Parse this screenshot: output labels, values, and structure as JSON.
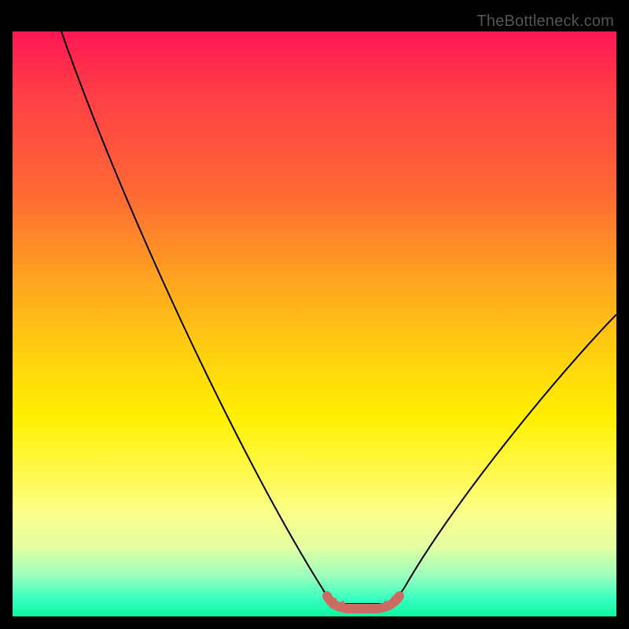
{
  "watermark": "TheBottleneck.com",
  "chart_data": {
    "type": "line",
    "title": "",
    "xlabel": "",
    "ylabel": "",
    "xlim": [
      0,
      100
    ],
    "ylim": [
      0,
      100
    ],
    "x": [
      0,
      5,
      10,
      15,
      20,
      25,
      30,
      35,
      40,
      45,
      50,
      52,
      54,
      56,
      58,
      60,
      62,
      64,
      70,
      75,
      80,
      85,
      90,
      95,
      100
    ],
    "values": [
      100,
      92,
      83,
      74,
      65,
      56,
      47,
      38,
      29,
      20,
      11,
      6,
      3,
      2,
      2,
      2,
      3,
      6,
      15,
      23,
      31,
      38,
      44,
      50,
      54
    ],
    "minimum_band_x": [
      52,
      63
    ],
    "minimum_value": 2,
    "background_gradient": [
      "#ff1753",
      "#ffa220",
      "#fff000",
      "#0cf7a0"
    ]
  }
}
